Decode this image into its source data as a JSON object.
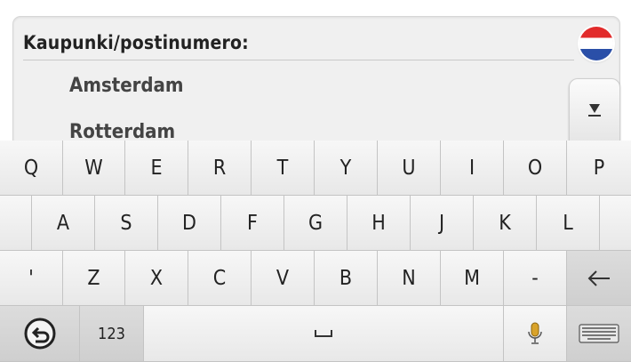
{
  "search": {
    "label": "Kaupunki/postinumero:",
    "flag_icon": "netherlands-flag-icon"
  },
  "suggestions": [
    "Amsterdam",
    "Rotterdam"
  ],
  "scroll": {
    "icon": "scroll-down-icon"
  },
  "keyboard": {
    "row1": [
      "Q",
      "W",
      "E",
      "R",
      "T",
      "Y",
      "U",
      "I",
      "O",
      "P"
    ],
    "row2": [
      "A",
      "S",
      "D",
      "F",
      "G",
      "H",
      "J",
      "K",
      "L"
    ],
    "row3": [
      "'",
      "Z",
      "X",
      "C",
      "V",
      "B",
      "N",
      "M",
      "-"
    ],
    "backspace_icon": "backspace-arrow-icon",
    "back_icon": "back-circle-icon",
    "numbers_label": "123",
    "space_icon": "space-bar-icon",
    "mic_icon": "microphone-icon",
    "keyboard_icon": "keyboard-icon"
  },
  "colors": {
    "flag_red": "#e22b2b",
    "flag_white": "#ffffff",
    "flag_blue": "#2a4fa8",
    "mic_gold": "#d9a32a"
  }
}
